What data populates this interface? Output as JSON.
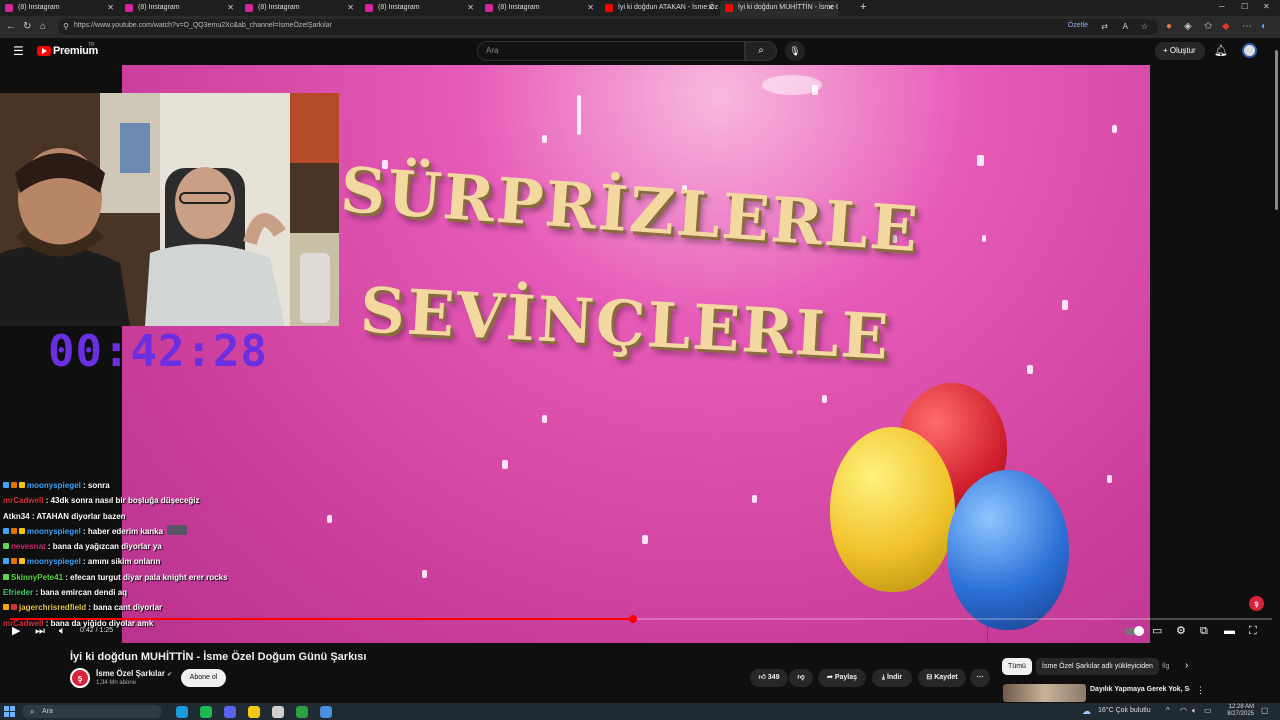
{
  "browser": {
    "tabs": [
      {
        "label": "(8) Instagram",
        "icon": "instagram-icon",
        "color": "#d6249f"
      },
      {
        "label": "(8) Instagram",
        "icon": "instagram-icon",
        "color": "#d6249f"
      },
      {
        "label": "(8) Instagram",
        "icon": "instagram-icon",
        "color": "#d6249f"
      },
      {
        "label": "(8) Instagram",
        "icon": "instagram-icon",
        "color": "#d6249f"
      },
      {
        "label": "(8) Instagram",
        "icon": "instagram-icon",
        "color": "#d6249f"
      },
      {
        "label": "İyi ki doğdun ATAKAN - İsme Öz",
        "icon": "youtube-icon",
        "color": "#ff0000"
      },
      {
        "label": "İyi ki doğdun MUHİTTİN - İsme Ö",
        "icon": "youtube-icon",
        "color": "#ff0000",
        "active": true
      }
    ],
    "new_tab": "+",
    "url": "https://www.youtube.com/watch?v=O_QQ3emu2Xc&ab_channel=İsmeÖzelŞarkılar",
    "summarize_label": "Özetle"
  },
  "youtube": {
    "logo_text": "Premium",
    "logo_sup": "TR",
    "search_placeholder": "Ara",
    "create_label": "Oluştur",
    "accent": "#ff0000"
  },
  "video": {
    "text_line1": "SÜRPRİZLERLE",
    "text_line2": "SEVİNÇLERLE",
    "current_time": "0:42",
    "duration": "1:25",
    "time_display": "0:42 / 1:25",
    "progress": 0.494,
    "channel_watermark": "ş"
  },
  "stream_overlay": {
    "timer": "00:42:28",
    "timer_color": "#6a2fe0"
  },
  "chat": [
    {
      "user": "moonyspiegel",
      "user_color": "#3ea6ff",
      "message": "sonra",
      "badges": [
        "#3ea6ff",
        "#e07000",
        "#f7c20a"
      ]
    },
    {
      "user": "mrCadwell",
      "user_color": "#d1323b",
      "message": "43dk sonra nasıl bir boşluğa düşeceğiz",
      "badges": []
    },
    {
      "user": "Atkn34",
      "user_color": "#ffffff",
      "message": "ATAHAN diyorlar bazen",
      "badges": []
    },
    {
      "user": "moonyspiegel",
      "user_color": "#3ea6ff",
      "message": "haber ederim kanka",
      "badges": [
        "#3ea6ff",
        "#e07000",
        "#f7c20a"
      ],
      "emote": true
    },
    {
      "user": "nevesnat",
      "user_color": "#d12a78",
      "message": "bana da yağızcan diyorlar ya",
      "badges": [
        "#5bd74f"
      ]
    },
    {
      "user": "moonyspiegel",
      "user_color": "#3ea6ff",
      "message": "amını sikim onların",
      "badges": [
        "#3ea6ff",
        "#e07000",
        "#f7c20a"
      ]
    },
    {
      "user": "SkinnyPete41",
      "user_color": "#57d63c",
      "message": "efecan turgut diyar pala knight erer rocks",
      "badges": [
        "#5bd74f"
      ]
    },
    {
      "user": "Efrieder",
      "user_color": "#44c767",
      "message": "bana emircan dendi aq",
      "badges": []
    },
    {
      "user": "jagerchrisredfield",
      "user_color": "#e6c34a",
      "message": "bana cant diyorlar",
      "badges": [
        "#f7a50a",
        "#d1323b"
      ]
    },
    {
      "user": "mrCadwell",
      "user_color": "#d1323b",
      "message": "bana da yiğido diyolar amk",
      "badges": []
    }
  ],
  "watch": {
    "title": "İyi ki doğdun MUHİTTİN - İsme Özel Doğum Günü Şarkısı",
    "channel_name": "İsme Özel Şarkılar",
    "verified_icon": "✔",
    "subscribers": "1,34 Mn abone",
    "subscribe_label": "Abone ol",
    "likes": "349",
    "share_label": "Paylaş",
    "download_label": "İndir",
    "save_label": "Kaydet",
    "more_label": "⋯"
  },
  "recommendations": {
    "chips": [
      "Tümü",
      "İsme Özel Şarkılar adlı yükleyiciden",
      "İlg"
    ],
    "first_title": "Dayılık Yapmaya Gerek Yok, Sonu Sonun Gideceğiz - Behzat"
  },
  "taskbar": {
    "search_placeholder": "Ara",
    "weather": "16°C  Çok bulutlu",
    "time": "12:28 AM",
    "date": "8/27/2025",
    "apps": [
      {
        "name": "edge-icon",
        "color": "#1e9be0"
      },
      {
        "name": "spotify-icon",
        "color": "#1db954"
      },
      {
        "name": "discord-icon",
        "color": "#5865f2"
      },
      {
        "name": "file-explorer-icon",
        "color": "#f2c811"
      },
      {
        "name": "obs-icon",
        "color": "#cfcfcf"
      },
      {
        "name": "xbox-icon",
        "color": "#2ea043"
      },
      {
        "name": "steam-icon",
        "color": "#4a90d9"
      }
    ]
  }
}
